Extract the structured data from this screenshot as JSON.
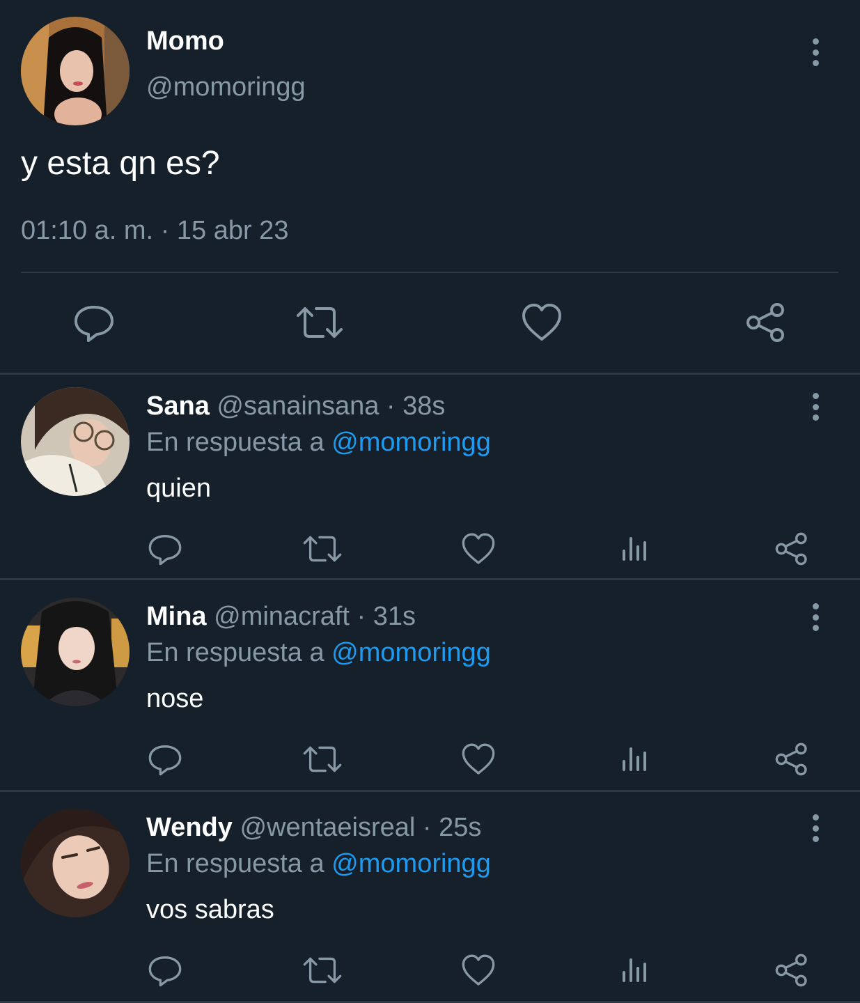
{
  "main_tweet": {
    "name": "Momo",
    "handle": "@momoringg",
    "text": "y esta qn es?",
    "timestamp": "01:10 a. m. · 15 abr 23",
    "avatar_colors": [
      "#b57a3a",
      "#1a1212"
    ],
    "actions": [
      "reply-icon",
      "retweet-icon",
      "like-icon",
      "share-icon"
    ]
  },
  "replies": [
    {
      "name": "Sana",
      "handle": "@sanainsana",
      "dot": "·",
      "time": "38s",
      "context_prefix": "En respuesta a",
      "mention": "@momoringg",
      "text": "quien",
      "avatar_colors": [
        "#e9e2d6",
        "#3a2a22"
      ]
    },
    {
      "name": "Mina",
      "handle": "@minacraft",
      "dot": "·",
      "time": "31s",
      "context_prefix": "En respuesta a",
      "mention": "@momoringg",
      "text": "nose",
      "avatar_colors": [
        "#d9a34a",
        "#222428"
      ]
    },
    {
      "name": "Wendy",
      "handle": "@wentaeisreal",
      "dot": "·",
      "time": "25s",
      "context_prefix": "En respuesta a",
      "mention": "@momoringg",
      "text": "vos sabras",
      "avatar_colors": [
        "#e6c2b0",
        "#2a1c18"
      ]
    }
  ],
  "reply_actions": [
    "reply-icon",
    "retweet-icon",
    "like-icon",
    "views-icon",
    "share-icon"
  ],
  "colors": {
    "background": "#16202b",
    "muted": "#8899a6",
    "accent": "#1d9bf0",
    "divider": "#2b3947"
  }
}
